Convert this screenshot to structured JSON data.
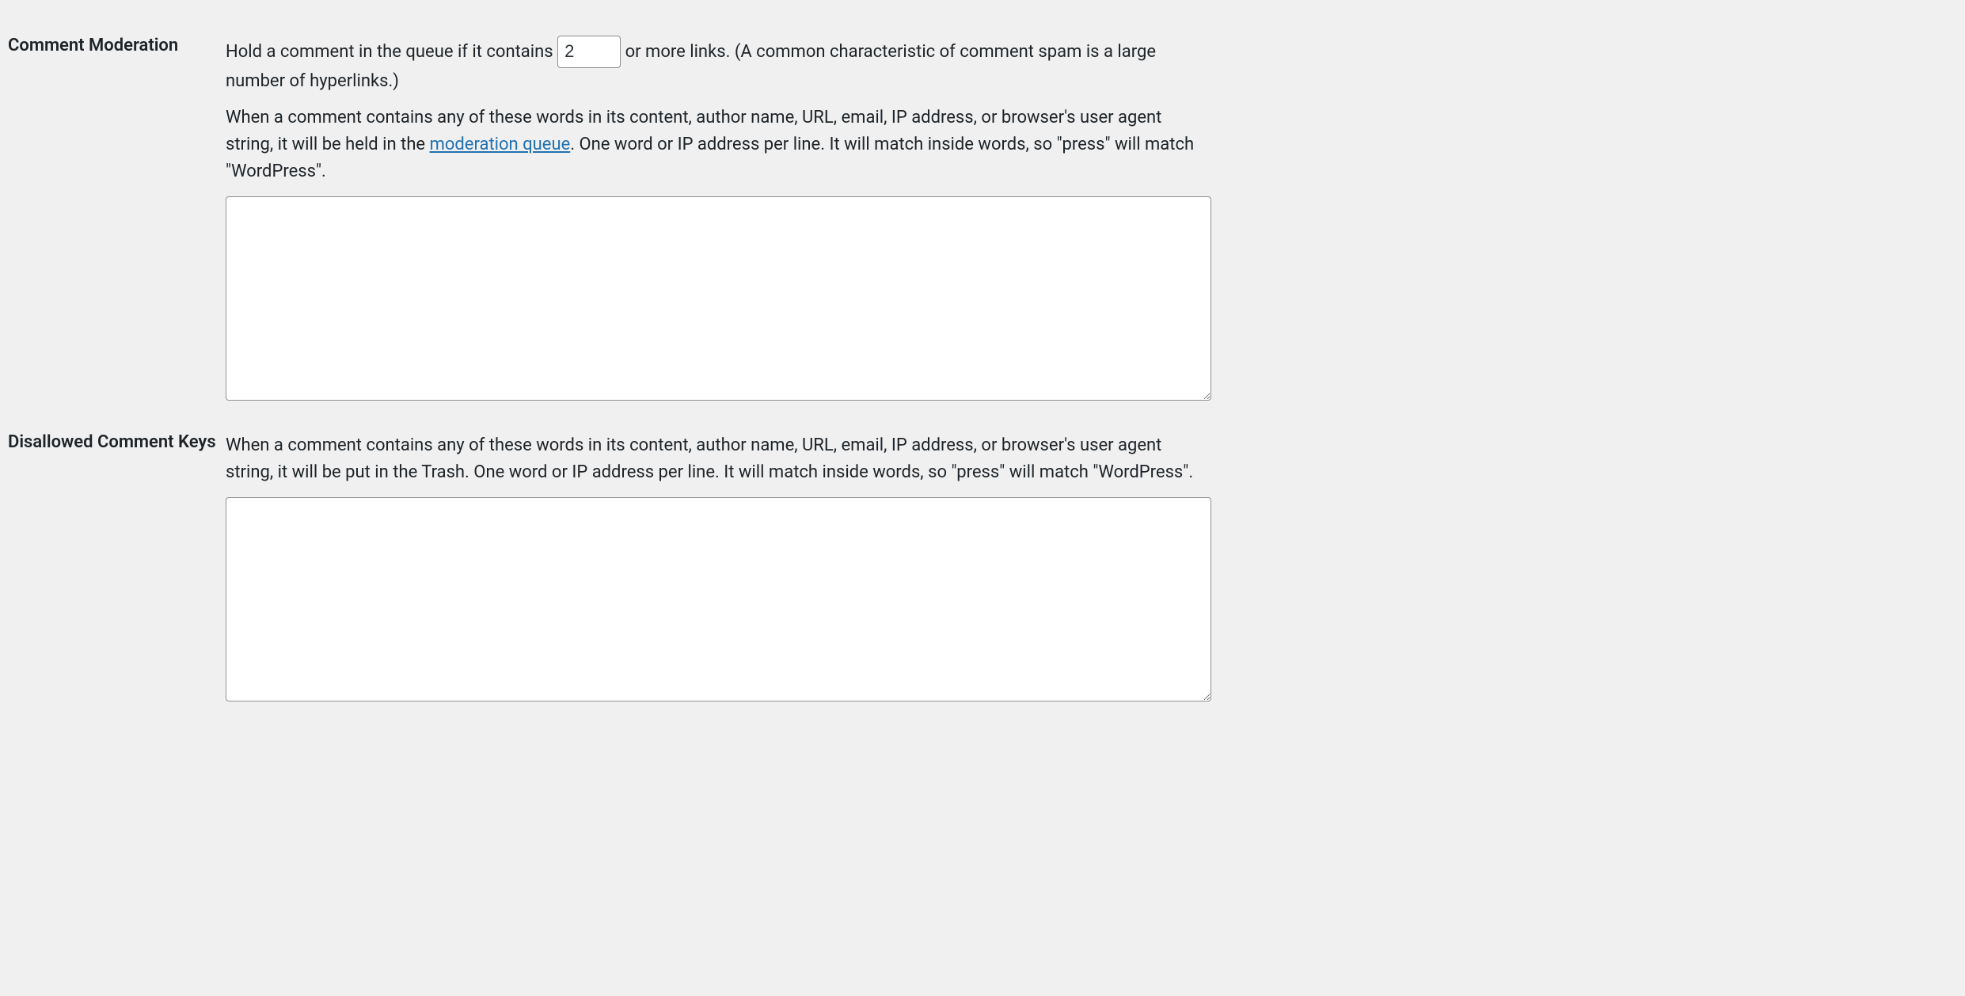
{
  "moderation": {
    "heading": "Comment Moderation",
    "hold_prefix": "Hold a comment in the queue if it contains ",
    "max_links_value": "2",
    "hold_suffix": " or more links. (A common characteristic of comment spam is a large number of hyperlinks.)",
    "desc_before_link": "When a comment contains any of these words in its content, author name, URL, email, IP address, or browser's user agent string, it will be held in the ",
    "link_text": "moderation queue",
    "desc_after_link": ". One word or IP address per line. It will match inside words, so \"press\" will match \"WordPress\".",
    "textarea_value": ""
  },
  "disallowed": {
    "heading": "Disallowed Comment Keys",
    "description": "When a comment contains any of these words in its content, author name, URL, email, IP address, or browser's user agent string, it will be put in the Trash. One word or IP address per line. It will match inside words, so \"press\" will match \"WordPress\".",
    "textarea_value": ""
  }
}
